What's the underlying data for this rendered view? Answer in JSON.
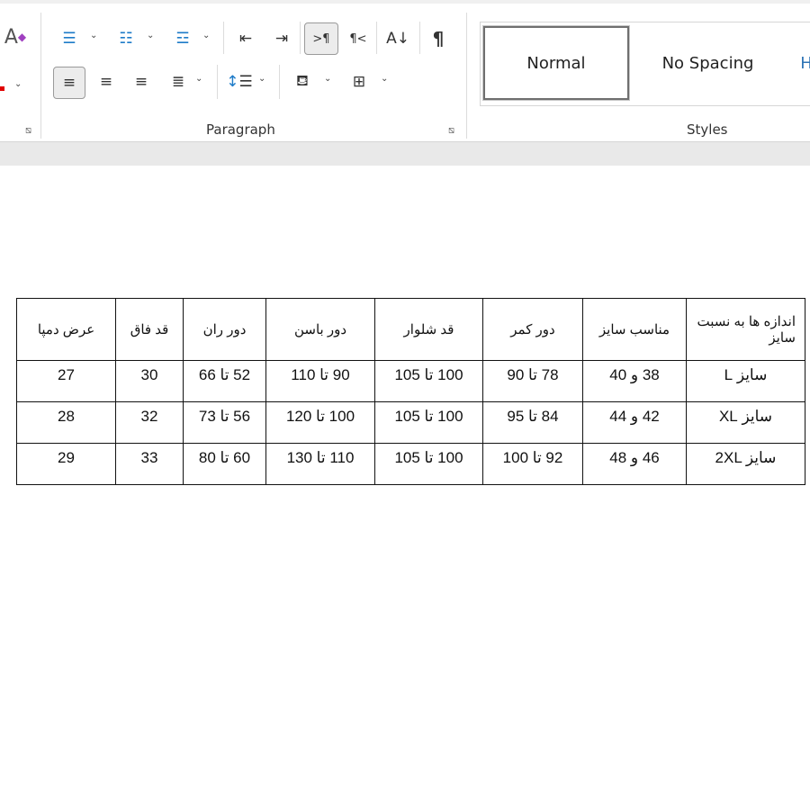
{
  "ribbon": {
    "paragraph_label": "Paragraph",
    "styles_label": "Styles",
    "styles": [
      "Normal",
      "No Spacing"
    ],
    "pilcrow": "¶",
    "ltr_icon": ">¶",
    "rtl_icon": "¶<",
    "sort_icon": "A↓"
  },
  "table": {
    "headers": [
      "اندازه ها به نسبت سایز",
      "مناسب سایز",
      "دور کمر",
      "قد شلوار",
      "دور باسن",
      "دور ران",
      "قد فاق",
      "عرض دمپا"
    ],
    "rows": [
      [
        "سایز   L",
        "38 و 40",
        "78 تا 90",
        "100 تا 105",
        "90 تا 110",
        "52 تا 66",
        "30",
        "27"
      ],
      [
        "سایز   XL",
        "42 و 44",
        "84 تا 95",
        "100 تا 105",
        "100 تا 120",
        "56 تا 73",
        "32",
        "28"
      ],
      [
        "2XL سایز",
        "46 و 48",
        "92 تا 100",
        "100 تا 105",
        "110 تا 130",
        "60 تا 80",
        "33",
        "29"
      ]
    ]
  },
  "colors": {
    "accent": "#1e7bc8",
    "font_color_swatch": "#e00000"
  }
}
